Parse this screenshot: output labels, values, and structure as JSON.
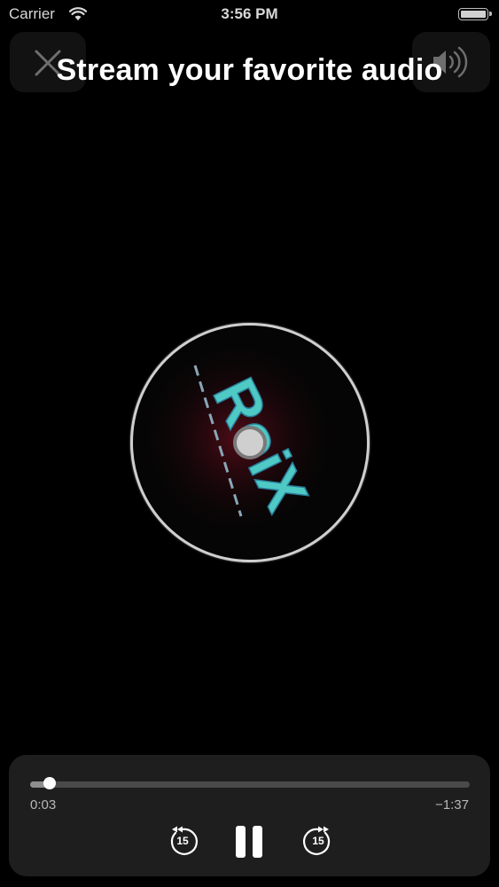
{
  "status_bar": {
    "carrier": "Carrier",
    "time": "3:56 PM"
  },
  "header": {
    "title": "Stream your favorite audio"
  },
  "artwork": {
    "logo_text": "RoiX"
  },
  "player": {
    "elapsed": "0:03",
    "remaining": "−1:37",
    "progress": 0.045,
    "skip_back_label": "15",
    "skip_forward_label": "15"
  },
  "colors": {
    "background": "#000000",
    "panel": "#1e1e1f",
    "text": "#ffffff",
    "artwork_accent": "#4fc9c4"
  },
  "icons": [
    "wifi-icon",
    "battery-icon",
    "close-icon",
    "volume-icon",
    "skip-back-15-icon",
    "pause-icon",
    "skip-forward-15-icon"
  ]
}
